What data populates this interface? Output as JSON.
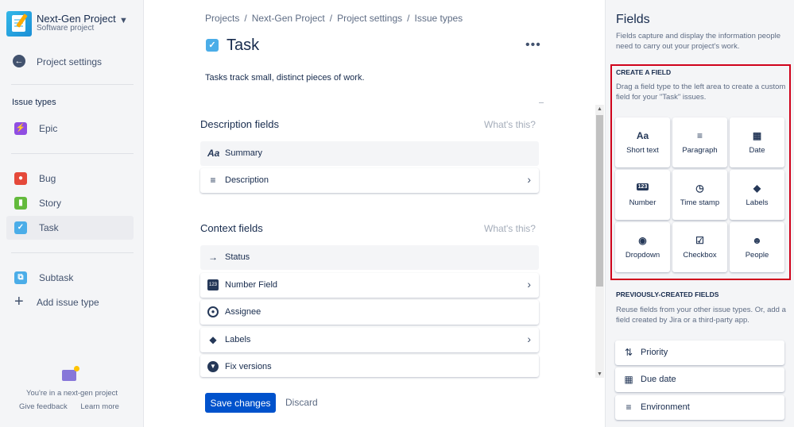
{
  "project": {
    "name": "Next-Gen Project",
    "type": "Software project"
  },
  "sidebar": {
    "back_label": "Project settings",
    "section_title": "Issue types",
    "items": [
      {
        "label": "Epic",
        "icon": "epic-icon",
        "color": "#904ee2"
      },
      {
        "label": "Bug",
        "icon": "bug-icon",
        "color": "#e5493a"
      },
      {
        "label": "Story",
        "icon": "story-icon",
        "color": "#63ba3c"
      },
      {
        "label": "Task",
        "icon": "task-icon",
        "color": "#4bade8"
      },
      {
        "label": "Subtask",
        "icon": "subtask-icon",
        "color": "#4bade8"
      }
    ],
    "add_label": "Add issue type",
    "footer_text": "You're in a next-gen project",
    "feedback_label": "Give feedback",
    "learn_label": "Learn more"
  },
  "breadcrumb": [
    "Projects",
    "Next-Gen Project",
    "Project settings",
    "Issue types"
  ],
  "issue": {
    "title": "Task",
    "description": "Tasks track small, distinct pieces of work."
  },
  "description_fields": {
    "title": "Description fields",
    "whats_this": "What's this?",
    "rows": [
      {
        "label": "Summary",
        "icon": "text-format-icon"
      },
      {
        "label": "Description",
        "icon": "paragraph-icon"
      }
    ]
  },
  "context_fields": {
    "title": "Context fields",
    "whats_this": "What's this?",
    "rows": [
      {
        "label": "Status",
        "icon": "arrow-right-icon"
      },
      {
        "label": "Number Field",
        "icon": "number-icon"
      },
      {
        "label": "Assignee",
        "icon": "person-icon"
      },
      {
        "label": "Labels",
        "icon": "label-icon"
      },
      {
        "label": "Fix versions",
        "icon": "dropdown-icon"
      }
    ]
  },
  "actions": {
    "save_label": "Save changes",
    "discard_label": "Discard"
  },
  "panel": {
    "title": "Fields",
    "subtitle": "Fields capture and display the information people need to carry out your project's work.",
    "create_title": "CREATE A FIELD",
    "create_subtitle": "Drag a field type to the left area to create a custom field for your \"Task\" issues.",
    "field_types": [
      {
        "label": "Short text",
        "icon": "text-format-icon"
      },
      {
        "label": "Paragraph",
        "icon": "paragraph-icon"
      },
      {
        "label": "Date",
        "icon": "calendar-icon"
      },
      {
        "label": "Number",
        "icon": "number-icon"
      },
      {
        "label": "Time stamp",
        "icon": "clock-icon"
      },
      {
        "label": "Labels",
        "icon": "label-icon"
      },
      {
        "label": "Dropdown",
        "icon": "dropdown-icon"
      },
      {
        "label": "Checkbox",
        "icon": "checkbox-icon"
      },
      {
        "label": "People",
        "icon": "person-icon"
      }
    ],
    "prev_title": "PREVIOUSLY-CREATED FIELDS",
    "prev_subtitle": "Reuse fields from your other issue types. Or, add a field created by Jira or a third-party app.",
    "prev_fields": [
      {
        "label": "Priority",
        "icon": "priority-icon"
      },
      {
        "label": "Due date",
        "icon": "calendar-icon"
      },
      {
        "label": "Environment",
        "icon": "paragraph-icon"
      }
    ]
  },
  "colors": {
    "primary": "#0052cc",
    "highlight": "#d0021b"
  }
}
